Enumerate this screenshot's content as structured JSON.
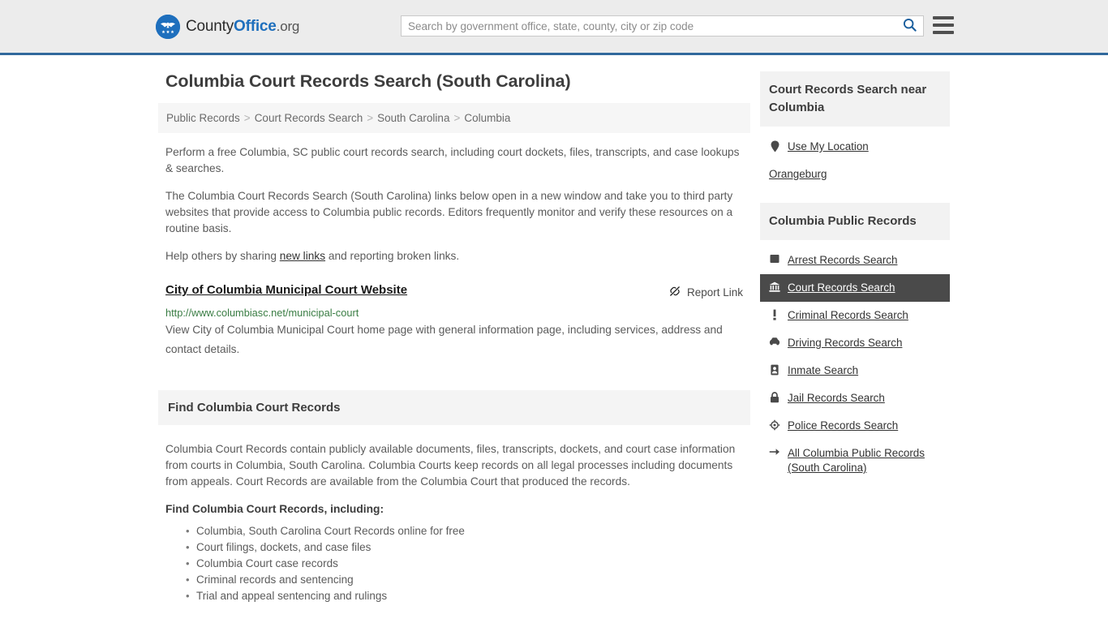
{
  "header": {
    "logo": {
      "icon": "eagle-seal-icon",
      "text_county": "County",
      "text_office": "Office",
      "text_org": ".org"
    },
    "search": {
      "placeholder": "Search by government office, state, county, city or zip code",
      "value": "",
      "icon": "search-icon"
    },
    "menu": {
      "icon": "hamburger-menu-icon",
      "label": "Menu"
    },
    "accent_color": "#31699c",
    "background_color": "#ececec"
  },
  "main": {
    "title": "Columbia Court Records Search (South Carolina)",
    "breadcrumb": [
      "Public Records",
      "Court Records Search",
      "South Carolina",
      "Columbia"
    ],
    "breadcrumb_separator": ">",
    "intro_paragraph": "Perform a free Columbia, SC public court records search, including court dockets, files, transcripts, and case lookups & searches.",
    "links_paragraph": "The Columbia Court Records Search (South Carolina) links below open in a new window and take you to third party websites that provide access to Columbia public records. Editors frequently monitor and verify these resources on a routine basis.",
    "help_prefix": "Help others by sharing ",
    "help_link": "new links",
    "help_suffix": " and reporting broken links.",
    "result": {
      "title": "City of Columbia Municipal Court Website",
      "url": "http://www.columbiasc.net/municipal-court",
      "description": "View City of Columbia Municipal Court home page with general information page, including services, address and contact details.",
      "report_label": "Report Link",
      "report_icon": "broken-link-icon",
      "url_color": "#3a7d44"
    },
    "section": {
      "heading": "Find Columbia Court Records",
      "paragraph": "Columbia Court Records contain publicly available documents, files, transcripts, dockets, and court case information from courts in Columbia, South Carolina. Columbia Courts keep records on all legal processes including documents from appeals. Court Records are available from the Columbia Court that produced the records.",
      "sub_heading": "Find Columbia Court Records, including:",
      "bullets": [
        "Columbia, South Carolina Court Records online for free",
        "Court filings, dockets, and case files",
        "Columbia Court case records",
        "Criminal records and sentencing",
        "Trial and appeal sentencing and rulings"
      ]
    }
  },
  "sidebar": {
    "near_card": {
      "heading": "Court Records Search near Columbia",
      "items": [
        {
          "label": "Use My Location",
          "icon": "map-pin-icon",
          "has_icon": true
        },
        {
          "label": "Orangeburg",
          "icon": "",
          "has_icon": false
        }
      ]
    },
    "records_card": {
      "heading": "Columbia Public Records",
      "active_color": "#4a4a4a",
      "items": [
        {
          "label": "Arrest Records Search",
          "icon": "square-icon",
          "active": false
        },
        {
          "label": "Court Records Search",
          "icon": "courthouse-icon",
          "active": true
        },
        {
          "label": "Criminal Records Search",
          "icon": "exclamation-icon",
          "active": false
        },
        {
          "label": "Driving Records Search",
          "icon": "car-icon",
          "active": false
        },
        {
          "label": "Inmate Search",
          "icon": "id-badge-icon",
          "active": false
        },
        {
          "label": "Jail Records Search",
          "icon": "padlock-icon",
          "active": false
        },
        {
          "label": "Police Records Search",
          "icon": "police-badge-icon",
          "active": false
        },
        {
          "label": "All Columbia Public Records (South Carolina)",
          "icon": "arrow-right-icon",
          "active": false
        }
      ]
    }
  }
}
